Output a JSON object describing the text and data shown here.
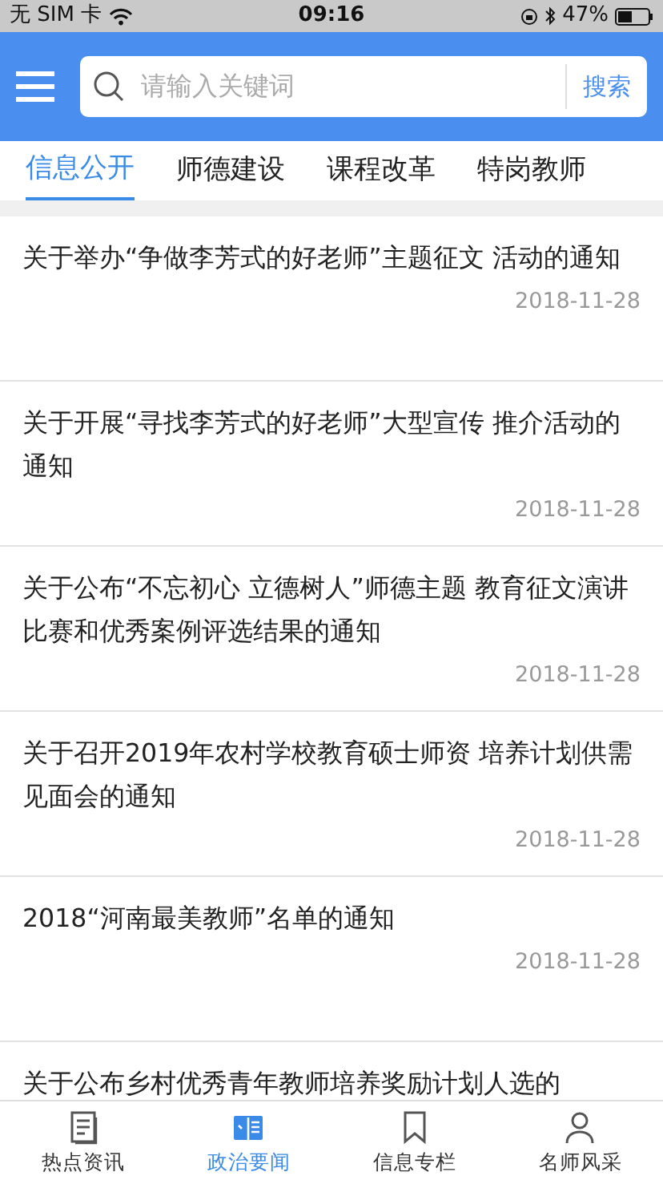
{
  "status_bar": {
    "carrier": "无 SIM 卡",
    "time": "09:16",
    "battery": "47%"
  },
  "search": {
    "placeholder": "请输入关键词",
    "button": "搜索"
  },
  "tabs": [
    {
      "label": "信息公开",
      "selected": true
    },
    {
      "label": "师德建设",
      "selected": false
    },
    {
      "label": "课程改革",
      "selected": false
    },
    {
      "label": "特岗教师",
      "selected": false
    }
  ],
  "articles": [
    {
      "title": "关于举办“争做李芳式的好老师”主题征文 活动的通知",
      "date": "2018-11-28"
    },
    {
      "title": "关于开展“寻找李芳式的好老师”大型宣传 推介活动的通知",
      "date": "2018-11-28"
    },
    {
      "title": "关于公布“不忘初心 立德树人”师德主题 教育征文演讲比赛和优秀案例评选结果的通知",
      "date": "2018-11-28"
    },
    {
      "title": "关于召开2019年农村学校教育硕士师资 培养计划供需见面会的通知",
      "date": "2018-11-28"
    },
    {
      "title": "2018“河南最美教师”名单的通知",
      "date": "2018-11-28"
    },
    {
      "title": "关于公布乡村优秀青年教师培养奖励计划人选的"
    }
  ],
  "bottom_nav": [
    {
      "label": "热点资讯",
      "kind": "doc",
      "selected": false
    },
    {
      "label": "政治要闻",
      "kind": "news",
      "selected": true
    },
    {
      "label": "信息专栏",
      "kind": "bookmark",
      "selected": false
    },
    {
      "label": "名师风采",
      "kind": "person",
      "selected": false
    }
  ]
}
